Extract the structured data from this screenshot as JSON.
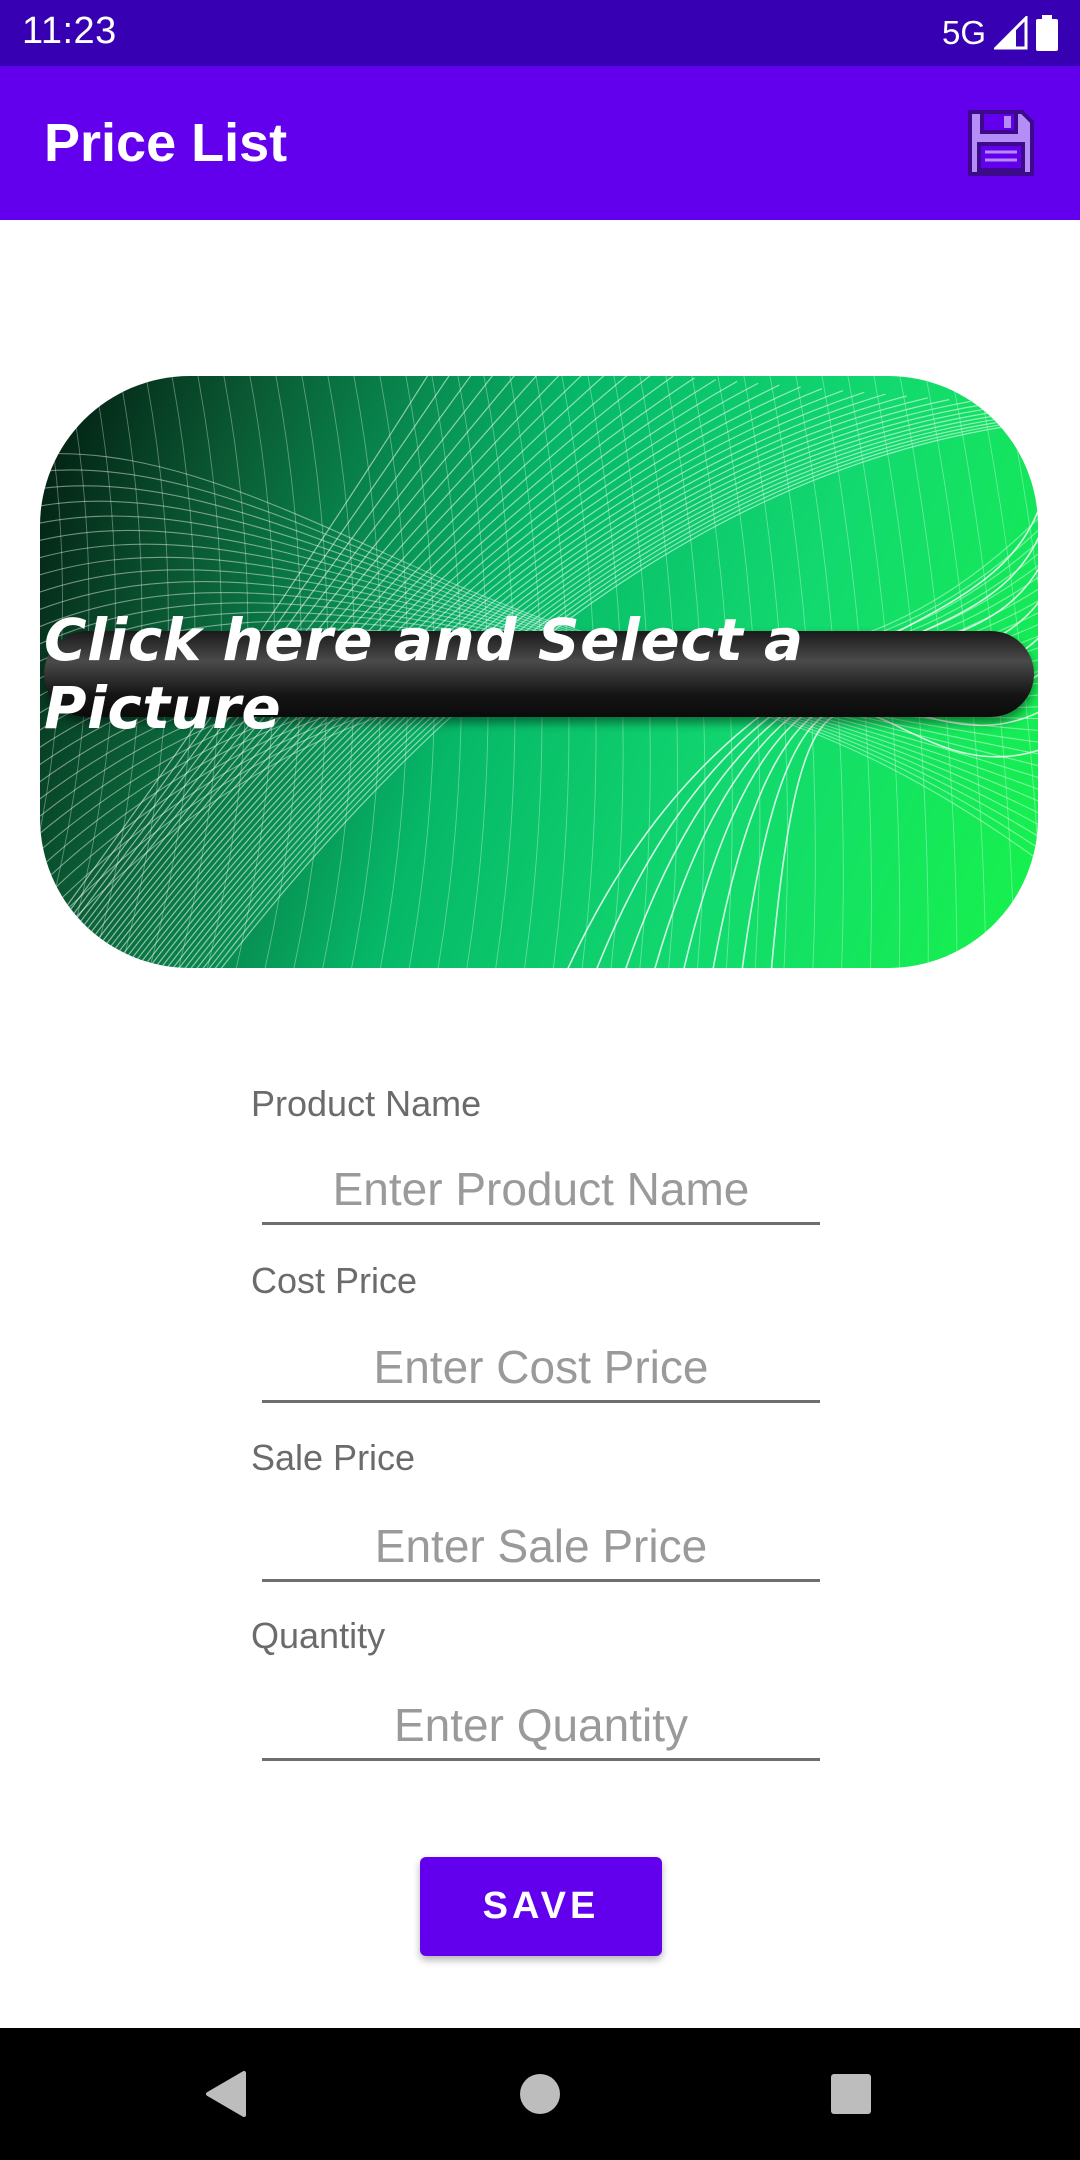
{
  "status_bar": {
    "time": "11:23",
    "network": "5G",
    "icons": [
      "signal-icon",
      "battery-icon"
    ]
  },
  "app_bar": {
    "title": "Price List",
    "save_icon": "floppy-disk-icon",
    "background_color": "#6200ee"
  },
  "picture_selector": {
    "label": "Click here and Select a Picture"
  },
  "form": {
    "fields": [
      {
        "label": "Product Name",
        "placeholder": "Enter Product Name",
        "value": ""
      },
      {
        "label": "Cost Price",
        "placeholder": "Enter Cost Price",
        "value": ""
      },
      {
        "label": "Sale Price",
        "placeholder": "Enter Sale Price",
        "value": ""
      },
      {
        "label": "Quantity",
        "placeholder": "Enter Quantity",
        "value": ""
      }
    ],
    "save_button": "SAVE"
  },
  "nav_bar": {
    "buttons": [
      "back-icon",
      "home-icon",
      "recents-icon"
    ]
  },
  "colors": {
    "primary": "#6200ee",
    "primary_dark": "#3700b3",
    "accent_green": "#17f34a"
  }
}
